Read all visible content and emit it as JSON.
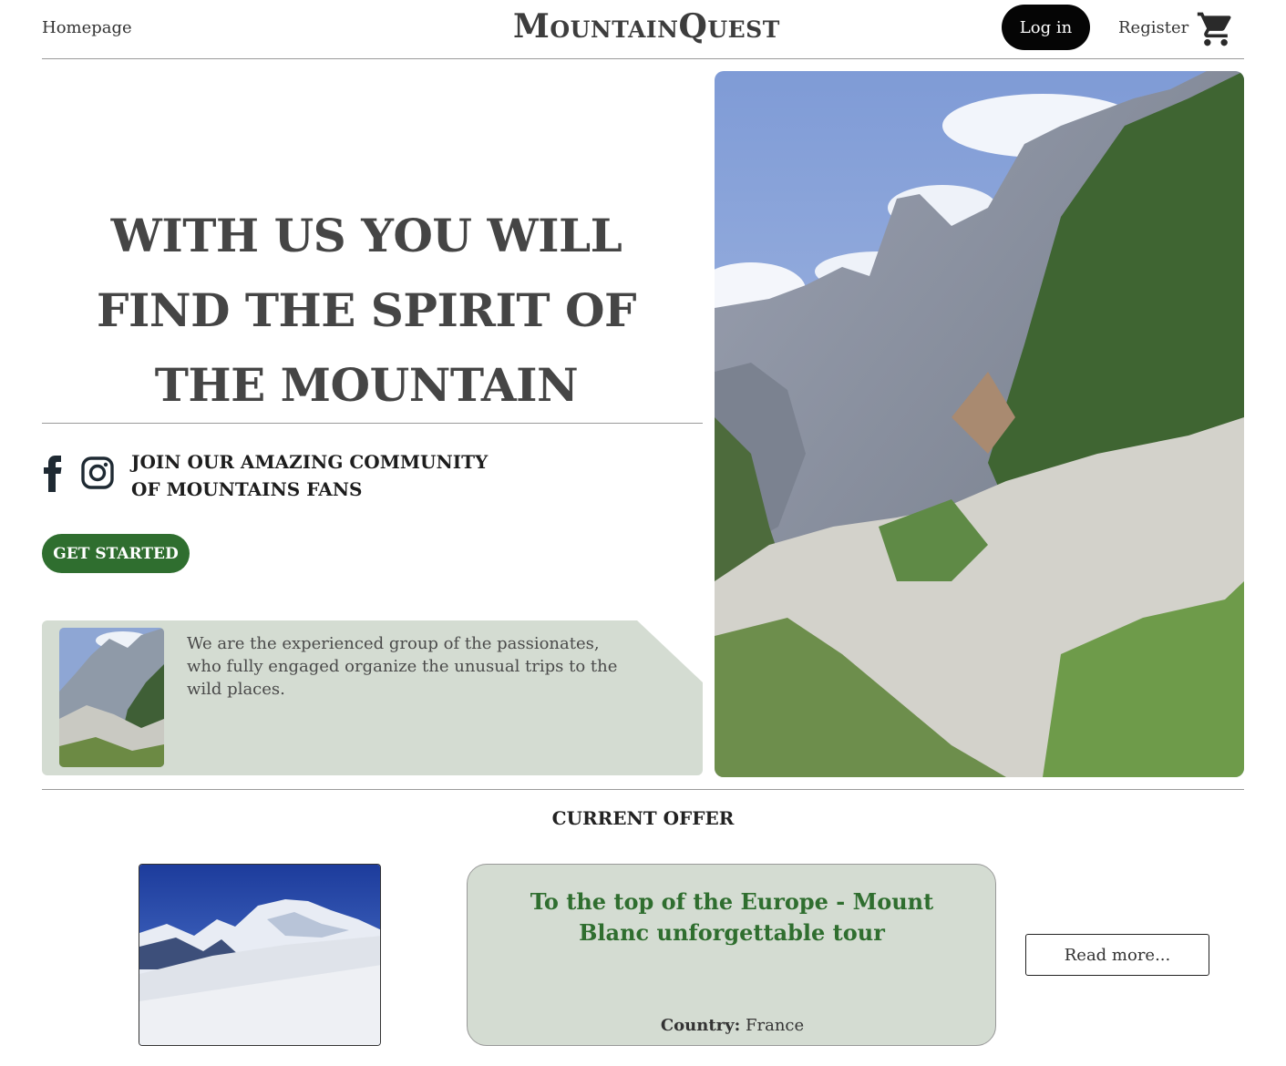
{
  "header": {
    "home_label": "Homepage",
    "logo": "MountainQuest",
    "login_label": "Log in",
    "register_label": "Register",
    "cart_icon": "shopping-cart-icon"
  },
  "hero": {
    "title": "WITH US YOU WILL FIND THE SPIRIT OF THE MOUNTAIN",
    "community_line1": "JOIN OUR AMAZING COMMUNITY",
    "community_line2": "OF MOUNTAINS FANS",
    "cta_label": "GET STARTED",
    "social_icons": [
      "facebook-icon",
      "instagram-icon"
    ]
  },
  "about": {
    "text": "We are the experienced group of the passionates, who fully engaged organize the unusual trips to the wild places."
  },
  "offer": {
    "heading": "CURRENT OFFER",
    "title": "To the top of the Europe - Mount Blanc unforgettable tour",
    "country_label": "Country:",
    "country_value": "France",
    "read_more_label": "Read more..."
  },
  "colors": {
    "accent_green": "#2f6e2f",
    "card_bg": "#d4dcd2",
    "login_bg": "#050505"
  }
}
